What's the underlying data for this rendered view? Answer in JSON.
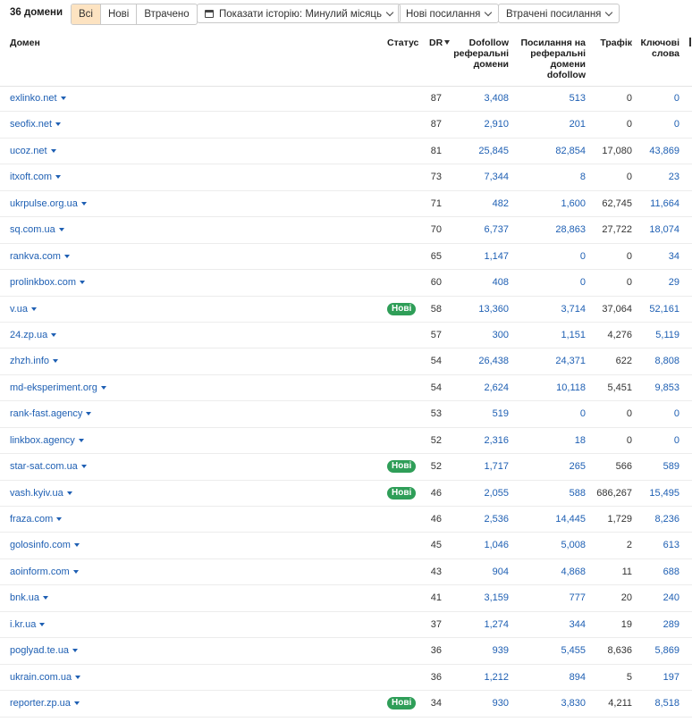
{
  "toolbar": {
    "count_label": "36 домени",
    "filters": [
      "Всі",
      "Нові",
      "Втрачено"
    ],
    "history_label": "Показати історію: Минулий місяць",
    "new_links_label": "Нові посилання",
    "lost_links_label": "Втрачені посилання"
  },
  "columns": {
    "domain": "Домен",
    "status": "Статус",
    "dr": "DR",
    "ref_domains": [
      "Dofollow",
      "реферальні",
      "домени"
    ],
    "dofollow_links": [
      "Посилання на",
      "реферальні",
      "домени",
      "dofollow"
    ],
    "traffic": "Трафік",
    "keywords": [
      "Ключові",
      "слова"
    ]
  },
  "rows": [
    {
      "domain": "exlinko.net",
      "status": "",
      "dr": "87",
      "ref": "3,408",
      "dof": "513",
      "traffic": "0",
      "kw": "0"
    },
    {
      "domain": "seofix.net",
      "status": "",
      "dr": "87",
      "ref": "2,910",
      "dof": "201",
      "traffic": "0",
      "kw": "0"
    },
    {
      "domain": "ucoz.net",
      "status": "",
      "dr": "81",
      "ref": "25,845",
      "dof": "82,854",
      "traffic": "17,080",
      "kw": "43,869"
    },
    {
      "domain": "itxoft.com",
      "status": "",
      "dr": "73",
      "ref": "7,344",
      "dof": "8",
      "traffic": "0",
      "kw": "23"
    },
    {
      "domain": "ukrpulse.org.ua",
      "status": "",
      "dr": "71",
      "ref": "482",
      "dof": "1,600",
      "traffic": "62,745",
      "kw": "11,664"
    },
    {
      "domain": "sq.com.ua",
      "status": "",
      "dr": "70",
      "ref": "6,737",
      "dof": "28,863",
      "traffic": "27,722",
      "kw": "18,074"
    },
    {
      "domain": "rankva.com",
      "status": "",
      "dr": "65",
      "ref": "1,147",
      "dof": "0",
      "traffic": "0",
      "kw": "34"
    },
    {
      "domain": "prolinkbox.com",
      "status": "",
      "dr": "60",
      "ref": "408",
      "dof": "0",
      "traffic": "0",
      "kw": "29"
    },
    {
      "domain": "v.ua",
      "status": "Нові",
      "dr": "58",
      "ref": "13,360",
      "dof": "3,714",
      "traffic": "37,064",
      "kw": "52,161"
    },
    {
      "domain": "24.zp.ua",
      "status": "",
      "dr": "57",
      "ref": "300",
      "dof": "1,151",
      "traffic": "4,276",
      "kw": "5,119"
    },
    {
      "domain": "zhzh.info",
      "status": "",
      "dr": "54",
      "ref": "26,438",
      "dof": "24,371",
      "traffic": "622",
      "kw": "8,808"
    },
    {
      "domain": "md-eksperiment.org",
      "status": "",
      "dr": "54",
      "ref": "2,624",
      "dof": "10,118",
      "traffic": "5,451",
      "kw": "9,853"
    },
    {
      "domain": "rank-fast.agency",
      "status": "",
      "dr": "53",
      "ref": "519",
      "dof": "0",
      "traffic": "0",
      "kw": "0"
    },
    {
      "domain": "linkbox.agency",
      "status": "",
      "dr": "52",
      "ref": "2,316",
      "dof": "18",
      "traffic": "0",
      "kw": "0"
    },
    {
      "domain": "star-sat.com.ua",
      "status": "Нові",
      "dr": "52",
      "ref": "1,717",
      "dof": "265",
      "traffic": "566",
      "kw": "589"
    },
    {
      "domain": "vash.kyiv.ua",
      "status": "Нові",
      "dr": "46",
      "ref": "2,055",
      "dof": "588",
      "traffic": "686,267",
      "kw": "15,495"
    },
    {
      "domain": "fraza.com",
      "status": "",
      "dr": "46",
      "ref": "2,536",
      "dof": "14,445",
      "traffic": "1,729",
      "kw": "8,236"
    },
    {
      "domain": "golosinfo.com",
      "status": "",
      "dr": "45",
      "ref": "1,046",
      "dof": "5,008",
      "traffic": "2",
      "kw": "613"
    },
    {
      "domain": "aoinform.com",
      "status": "",
      "dr": "43",
      "ref": "904",
      "dof": "4,868",
      "traffic": "11",
      "kw": "688"
    },
    {
      "domain": "bnk.ua",
      "status": "",
      "dr": "41",
      "ref": "3,159",
      "dof": "777",
      "traffic": "20",
      "kw": "240"
    },
    {
      "domain": "i.kr.ua",
      "status": "",
      "dr": "37",
      "ref": "1,274",
      "dof": "344",
      "traffic": "19",
      "kw": "289"
    },
    {
      "domain": "poglyad.te.ua",
      "status": "",
      "dr": "36",
      "ref": "939",
      "dof": "5,455",
      "traffic": "8,636",
      "kw": "5,869"
    },
    {
      "domain": "ukrain.com.ua",
      "status": "",
      "dr": "36",
      "ref": "1,212",
      "dof": "894",
      "traffic": "5",
      "kw": "197"
    },
    {
      "domain": "reporter.zp.ua",
      "status": "Нові",
      "dr": "34",
      "ref": "930",
      "dof": "3,830",
      "traffic": "4,211",
      "kw": "8,518"
    }
  ]
}
